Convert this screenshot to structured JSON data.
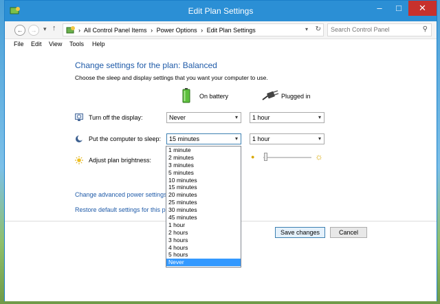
{
  "window": {
    "title": "Edit Plan Settings",
    "minimize": "–",
    "maximize": "□",
    "close": "✕"
  },
  "nav": {
    "back": "←",
    "forward": "→",
    "dropdown": "▾",
    "up": "↑",
    "crumb_sep": "›",
    "crumbs": [
      "All Control Panel Items",
      "Power Options",
      "Edit Plan Settings"
    ],
    "address_dropdown": "▾",
    "refresh": "↻"
  },
  "search": {
    "placeholder": "Search Control Panel",
    "icon": "⚲"
  },
  "menu": {
    "items": [
      "File",
      "Edit",
      "View",
      "Tools",
      "Help"
    ]
  },
  "page": {
    "heading": "Change settings for the plan: Balanced",
    "subtext": "Choose the sleep and display settings that you want your computer to use.",
    "col_battery": "On battery",
    "col_plugged": "Plugged in"
  },
  "rows": {
    "display": {
      "label": "Turn off the display:",
      "battery": "Never",
      "plugged": "1 hour"
    },
    "sleep": {
      "label": "Put the computer to sleep:",
      "battery": "15 minutes",
      "plugged": "1 hour"
    },
    "brightness": {
      "label": "Adjust plan brightness:",
      "plugged_level": 0.05
    }
  },
  "dropdown_arrow": "▾",
  "dropdown": {
    "options": [
      "1 minute",
      "2 minutes",
      "3 minutes",
      "5 minutes",
      "10 minutes",
      "15 minutes",
      "20 minutes",
      "25 minutes",
      "30 minutes",
      "45 minutes",
      "1 hour",
      "2 hours",
      "3 hours",
      "4 hours",
      "5 hours",
      "Never"
    ],
    "highlighted": "Never"
  },
  "links": {
    "advanced": "Change advanced power settings",
    "restore": "Restore default settings for this pla"
  },
  "buttons": {
    "save": "Save changes",
    "cancel": "Cancel"
  },
  "colors": {
    "titlebar": "#2b8fd5",
    "close": "#c7312c",
    "link": "#1e5aa8",
    "highlight": "#3399ff"
  }
}
